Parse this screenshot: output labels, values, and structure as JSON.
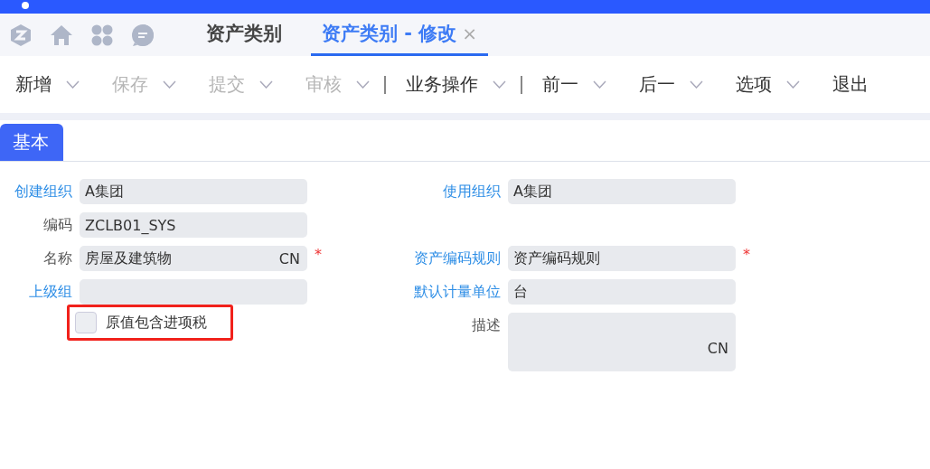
{
  "nav_tabs": [
    {
      "label": "资产类别",
      "selected": false
    },
    {
      "label": "资产类别 - 修改",
      "selected": true,
      "close": "×"
    }
  ],
  "toolbar": [
    {
      "kind": "button",
      "label": "新增",
      "disabled": false,
      "dropdown": true
    },
    {
      "kind": "button",
      "label": "保存",
      "disabled": true,
      "dropdown": true
    },
    {
      "kind": "button",
      "label": "提交",
      "disabled": true,
      "dropdown": true
    },
    {
      "kind": "button",
      "label": "审核",
      "disabled": true,
      "dropdown": true
    },
    {
      "kind": "separator"
    },
    {
      "kind": "button",
      "label": "业务操作",
      "disabled": false,
      "dropdown": true
    },
    {
      "kind": "separator"
    },
    {
      "kind": "button",
      "label": "前一",
      "disabled": false,
      "dropdown": true
    },
    {
      "kind": "button",
      "label": "后一",
      "disabled": false,
      "dropdown": true
    },
    {
      "kind": "button",
      "label": "选项",
      "disabled": false,
      "dropdown": true
    },
    {
      "kind": "button",
      "label": "退出",
      "disabled": false,
      "dropdown": false
    }
  ],
  "form_tabs": [
    {
      "label": "基本",
      "selected": true
    }
  ],
  "left_fields": [
    {
      "kind": "text",
      "label": "创建组织",
      "link": true,
      "value": "A集团"
    },
    {
      "kind": "text",
      "label": "编码",
      "link": false,
      "value": "ZCLB01_SYS"
    },
    {
      "kind": "text",
      "label": "名称",
      "link": false,
      "value": "房屋及建筑物",
      "lang": "CN",
      "required_mark": "*"
    },
    {
      "kind": "text",
      "label": "上级组",
      "link": true
    },
    {
      "kind": "checkbox",
      "label": "原值包含进项税",
      "checked": false,
      "highlighted": true
    }
  ],
  "right_fields": [
    {
      "kind": "text",
      "label": "使用组织",
      "link": true,
      "value": "A集团"
    },
    {
      "kind": "blank"
    },
    {
      "kind": "text",
      "label": "资产编码规则",
      "link": true,
      "value": "资产编码规则",
      "required_mark": "*"
    },
    {
      "kind": "text",
      "label": "默认计量单位",
      "link": true,
      "value": "台"
    },
    {
      "kind": "textarea",
      "label": "描述",
      "link": false,
      "lang": "CN"
    }
  ]
}
